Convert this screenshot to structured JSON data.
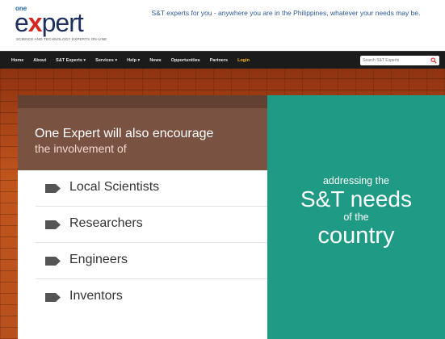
{
  "header": {
    "logo_prefix": "one",
    "logo_word_pre": "e",
    "logo_word_x": "x",
    "logo_word_post": "pert",
    "logo_tagline": "SCIENCE AND TECHNOLOGY EXPERTS ON-LINE",
    "tagline": "S&T experts for you - anywhere you are in the Philippines, whatever your needs may be."
  },
  "nav": {
    "items": [
      {
        "label": "Home"
      },
      {
        "label": "About"
      },
      {
        "label": "S&T Experts ▾"
      },
      {
        "label": "Services ▾"
      },
      {
        "label": "Help ▾"
      },
      {
        "label": "News"
      },
      {
        "label": "Opportunities"
      },
      {
        "label": "Partners"
      },
      {
        "label": "Login",
        "highlight": true
      }
    ],
    "search_placeholder": "Search S&T Experts",
    "search_icon": "magnifier-icon"
  },
  "left_panel": {
    "heading_line1": "One Expert will also encourage",
    "heading_line2": "the involvement of",
    "items": [
      {
        "label": "Local Scientists",
        "icon": "tag-icon"
      },
      {
        "label": "Researchers",
        "icon": "tag-icon"
      },
      {
        "label": "Engineers",
        "icon": "tag-icon"
      },
      {
        "label": "Inventors",
        "icon": "tag-icon"
      }
    ]
  },
  "right_panel": {
    "line1": "addressing the",
    "line2": "S&T needs",
    "line3": "of the",
    "line4": "country"
  },
  "colors": {
    "nav_bg": "#1b1b1b",
    "brick": "#b14818",
    "panel_brown": "#7a5242",
    "panel_teal": "#1f9a85",
    "login": "#f2b71b",
    "logo_red": "#d7241c",
    "logo_navy": "#1d2f5c"
  }
}
